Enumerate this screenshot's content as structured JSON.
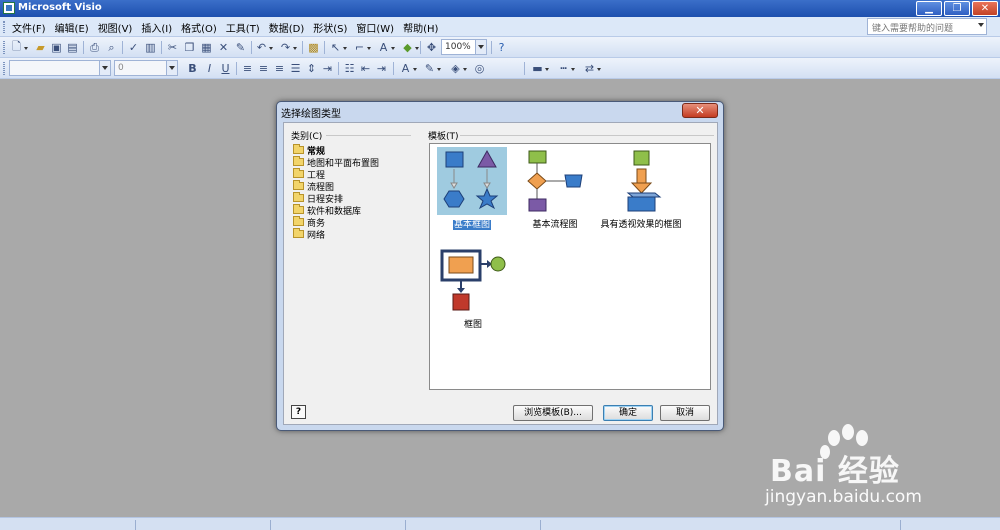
{
  "window": {
    "title": "Microsoft Visio",
    "minimize_glyph": "▁",
    "restore_glyph": "❐",
    "close_glyph": "✕"
  },
  "menubar": {
    "items": [
      "文件(F)",
      "编辑(E)",
      "视图(V)",
      "插入(I)",
      "格式(O)",
      "工具(T)",
      "数据(D)",
      "形状(S)",
      "窗口(W)",
      "帮助(H)"
    ],
    "help_placeholder": "键入需要帮助的问题"
  },
  "toolbar1": {
    "zoom_value": "100%",
    "icons": [
      "new-icon",
      "open-icon",
      "save-icon",
      "permission-icon",
      "print-icon",
      "print-preview-icon",
      "spelling-icon",
      "research-icon",
      "cut-icon",
      "copy-icon",
      "paste-icon",
      "delete-icon",
      "format-painter-icon",
      "undo-icon",
      "redo-icon",
      "shapes-icon",
      "pointer-icon",
      "connector-icon",
      "text-icon",
      "connection-point-icon",
      "pan-zoom-icon",
      "help-icon"
    ]
  },
  "toolbar2": {
    "font_value": "",
    "size_value": "0",
    "bold": "B",
    "italic": "I",
    "underline": "U"
  },
  "dialog": {
    "title": "选择绘图类型",
    "close_glyph": "✕",
    "category_label": "类别(C)",
    "categories": [
      {
        "label": "常规",
        "selected": true
      },
      {
        "label": "地图和平面布置图",
        "selected": false
      },
      {
        "label": "工程",
        "selected": false
      },
      {
        "label": "流程图",
        "selected": false
      },
      {
        "label": "日程安排",
        "selected": false
      },
      {
        "label": "软件和数据库",
        "selected": false
      },
      {
        "label": "商务",
        "selected": false
      },
      {
        "label": "网络",
        "selected": false
      }
    ],
    "template_label": "模板(T)",
    "templates": [
      {
        "label": "基本框图",
        "selected": true
      },
      {
        "label": "基本流程图",
        "selected": false
      },
      {
        "label": "具有透视效果的框图",
        "selected": false
      },
      {
        "label": "框图",
        "selected": false
      }
    ],
    "help_glyph": "?",
    "browse_button": "浏览模板(B)...",
    "ok_button": "确定",
    "cancel_button": "取消"
  },
  "watermark": {
    "brand": "Bai  经验",
    "url": "jingyan.baidu.com"
  },
  "colors": {
    "titlebar": "#1d4fae",
    "menubar": "#dce8f8",
    "workspace": "#a9a9a9",
    "dialog_frame": "#c9d8ee",
    "selection": "#3a7cc9",
    "shape_blue": "#3a7cc9",
    "shape_green": "#8fbf4a",
    "shape_orange": "#f0a050",
    "shape_purple": "#7b5aa6",
    "shape_red": "#c0392b"
  }
}
